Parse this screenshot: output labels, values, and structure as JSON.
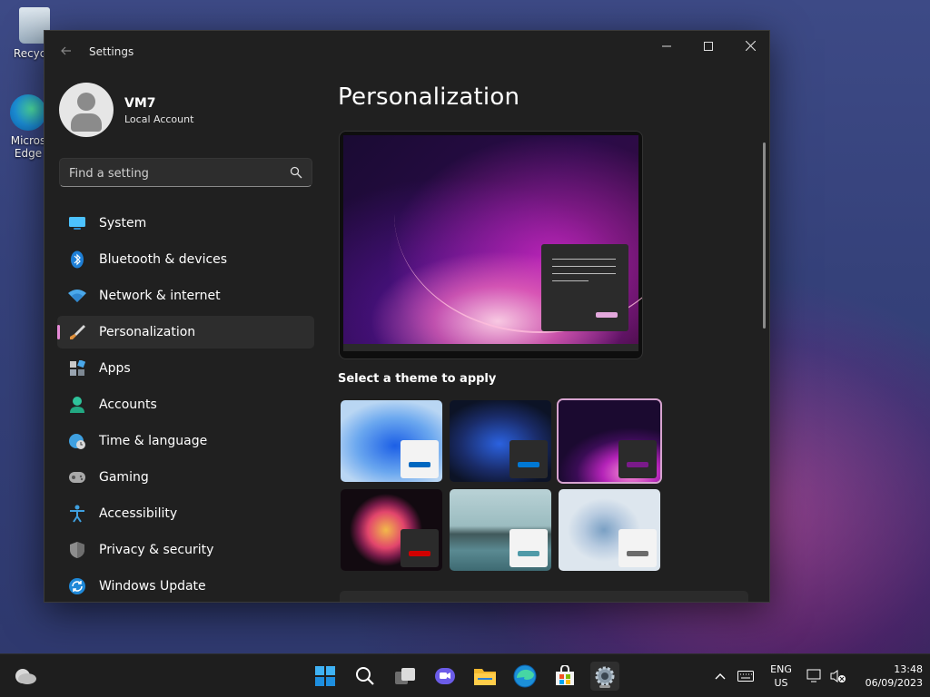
{
  "desktop": {
    "icons": [
      {
        "label": "Recycle"
      },
      {
        "label": "Micros Edge"
      }
    ]
  },
  "window": {
    "title": "Settings"
  },
  "profile": {
    "name": "VM7",
    "account_type": "Local Account"
  },
  "search": {
    "placeholder": "Find a setting"
  },
  "sidebar": {
    "items": [
      {
        "label": "System",
        "icon": "monitor-icon",
        "active": false
      },
      {
        "label": "Bluetooth & devices",
        "icon": "bluetooth-icon",
        "active": false
      },
      {
        "label": "Network & internet",
        "icon": "wifi-icon",
        "active": false
      },
      {
        "label": "Personalization",
        "icon": "brush-icon",
        "active": true
      },
      {
        "label": "Apps",
        "icon": "apps-icon",
        "active": false
      },
      {
        "label": "Accounts",
        "icon": "person-icon",
        "active": false
      },
      {
        "label": "Time & language",
        "icon": "globe-clock-icon",
        "active": false
      },
      {
        "label": "Gaming",
        "icon": "gamepad-icon",
        "active": false
      },
      {
        "label": "Accessibility",
        "icon": "accessibility-icon",
        "active": false
      },
      {
        "label": "Privacy & security",
        "icon": "shield-icon",
        "active": false
      },
      {
        "label": "Windows Update",
        "icon": "update-icon",
        "active": false
      }
    ]
  },
  "main": {
    "title": "Personalization",
    "themes_label": "Select a theme to apply",
    "themes": [
      {
        "name": "windows-light",
        "accent": "#0067c0",
        "selected": false
      },
      {
        "name": "windows-dark",
        "accent": "#0078d4",
        "selected": false
      },
      {
        "name": "glow",
        "accent": "#7a1a8a",
        "selected": true
      },
      {
        "name": "captured-motion",
        "accent": "#d10000",
        "selected": false
      },
      {
        "name": "sunrise",
        "accent": "#4f9aa8",
        "selected": false
      },
      {
        "name": "flow",
        "accent": "#6b6b6b",
        "selected": false
      }
    ]
  },
  "taskbar": {
    "language_top": "ENG",
    "language_bottom": "US",
    "time": "13:48",
    "date": "06/09/2023"
  },
  "colors": {
    "accent": "#e58ad6",
    "window_bg": "#202020",
    "taskbar_bg": "#1e1e1e"
  }
}
